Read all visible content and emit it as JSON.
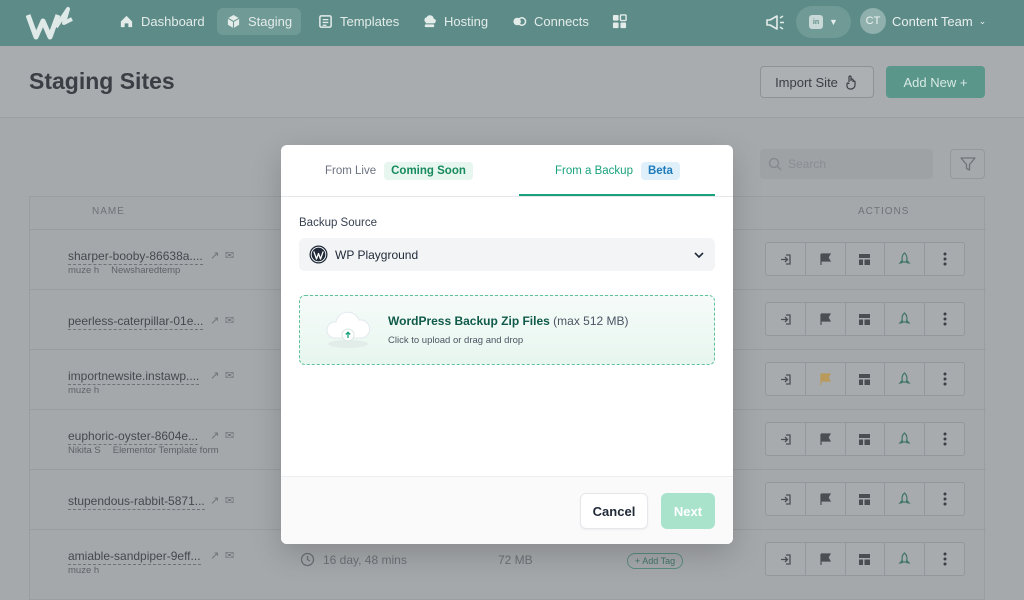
{
  "nav": {
    "items": [
      {
        "label": "Dashboard",
        "icon": "home-icon"
      },
      {
        "label": "Staging",
        "icon": "cube-icon",
        "active": true
      },
      {
        "label": "Templates",
        "icon": "template-icon"
      },
      {
        "label": "Hosting",
        "icon": "cloud-server-icon"
      },
      {
        "label": "Connects",
        "icon": "connects-icon"
      },
      {
        "label": "",
        "icon": "apps-grid-icon"
      }
    ],
    "avatar_initials": "CT",
    "team_name": "Content Team",
    "pill_icon_text": "in"
  },
  "header": {
    "title": "Staging Sites",
    "import_label": "Import Site",
    "add_new_label": "Add New +"
  },
  "list": {
    "search_placeholder": "Search",
    "col_name": "NAME",
    "col_actions": "ACTIONS",
    "rows": [
      {
        "name": "sharper-booby-86638a....",
        "user": "muze h",
        "template": "Newsharedtemp"
      },
      {
        "name": "peerless-caterpillar-01e...",
        "user": "",
        "template": ""
      },
      {
        "name": "importnewsite.instawp....",
        "user": "muze h",
        "template": ""
      },
      {
        "name": "euphoric-oyster-8604e...",
        "user": "Nikita S",
        "template": "Elementor Template form"
      },
      {
        "name": "stupendous-rabbit-5871...",
        "user": "",
        "template": ""
      },
      {
        "name": "amiable-sandpiper-9eff...",
        "user": "muze h",
        "template": "",
        "time": "16 day, 48 mins",
        "size": "72 MB",
        "tag": "+ Add Tag"
      }
    ]
  },
  "modal": {
    "tab_live": "From Live",
    "tab_live_badge": "Coming Soon",
    "tab_backup": "From a Backup",
    "tab_backup_badge": "Beta",
    "source_label": "Backup Source",
    "source_value": "WP Playground",
    "dropzone_title": "WordPress Backup Zip Files",
    "dropzone_limit": "(max 512 MB)",
    "dropzone_sub": "Click to upload or drag and drop",
    "cancel_label": "Cancel",
    "next_label": "Next"
  },
  "colors": {
    "nav_bg": "#5d8c88",
    "accent": "#19a27c",
    "next_disabled": "#a9e3cc"
  }
}
